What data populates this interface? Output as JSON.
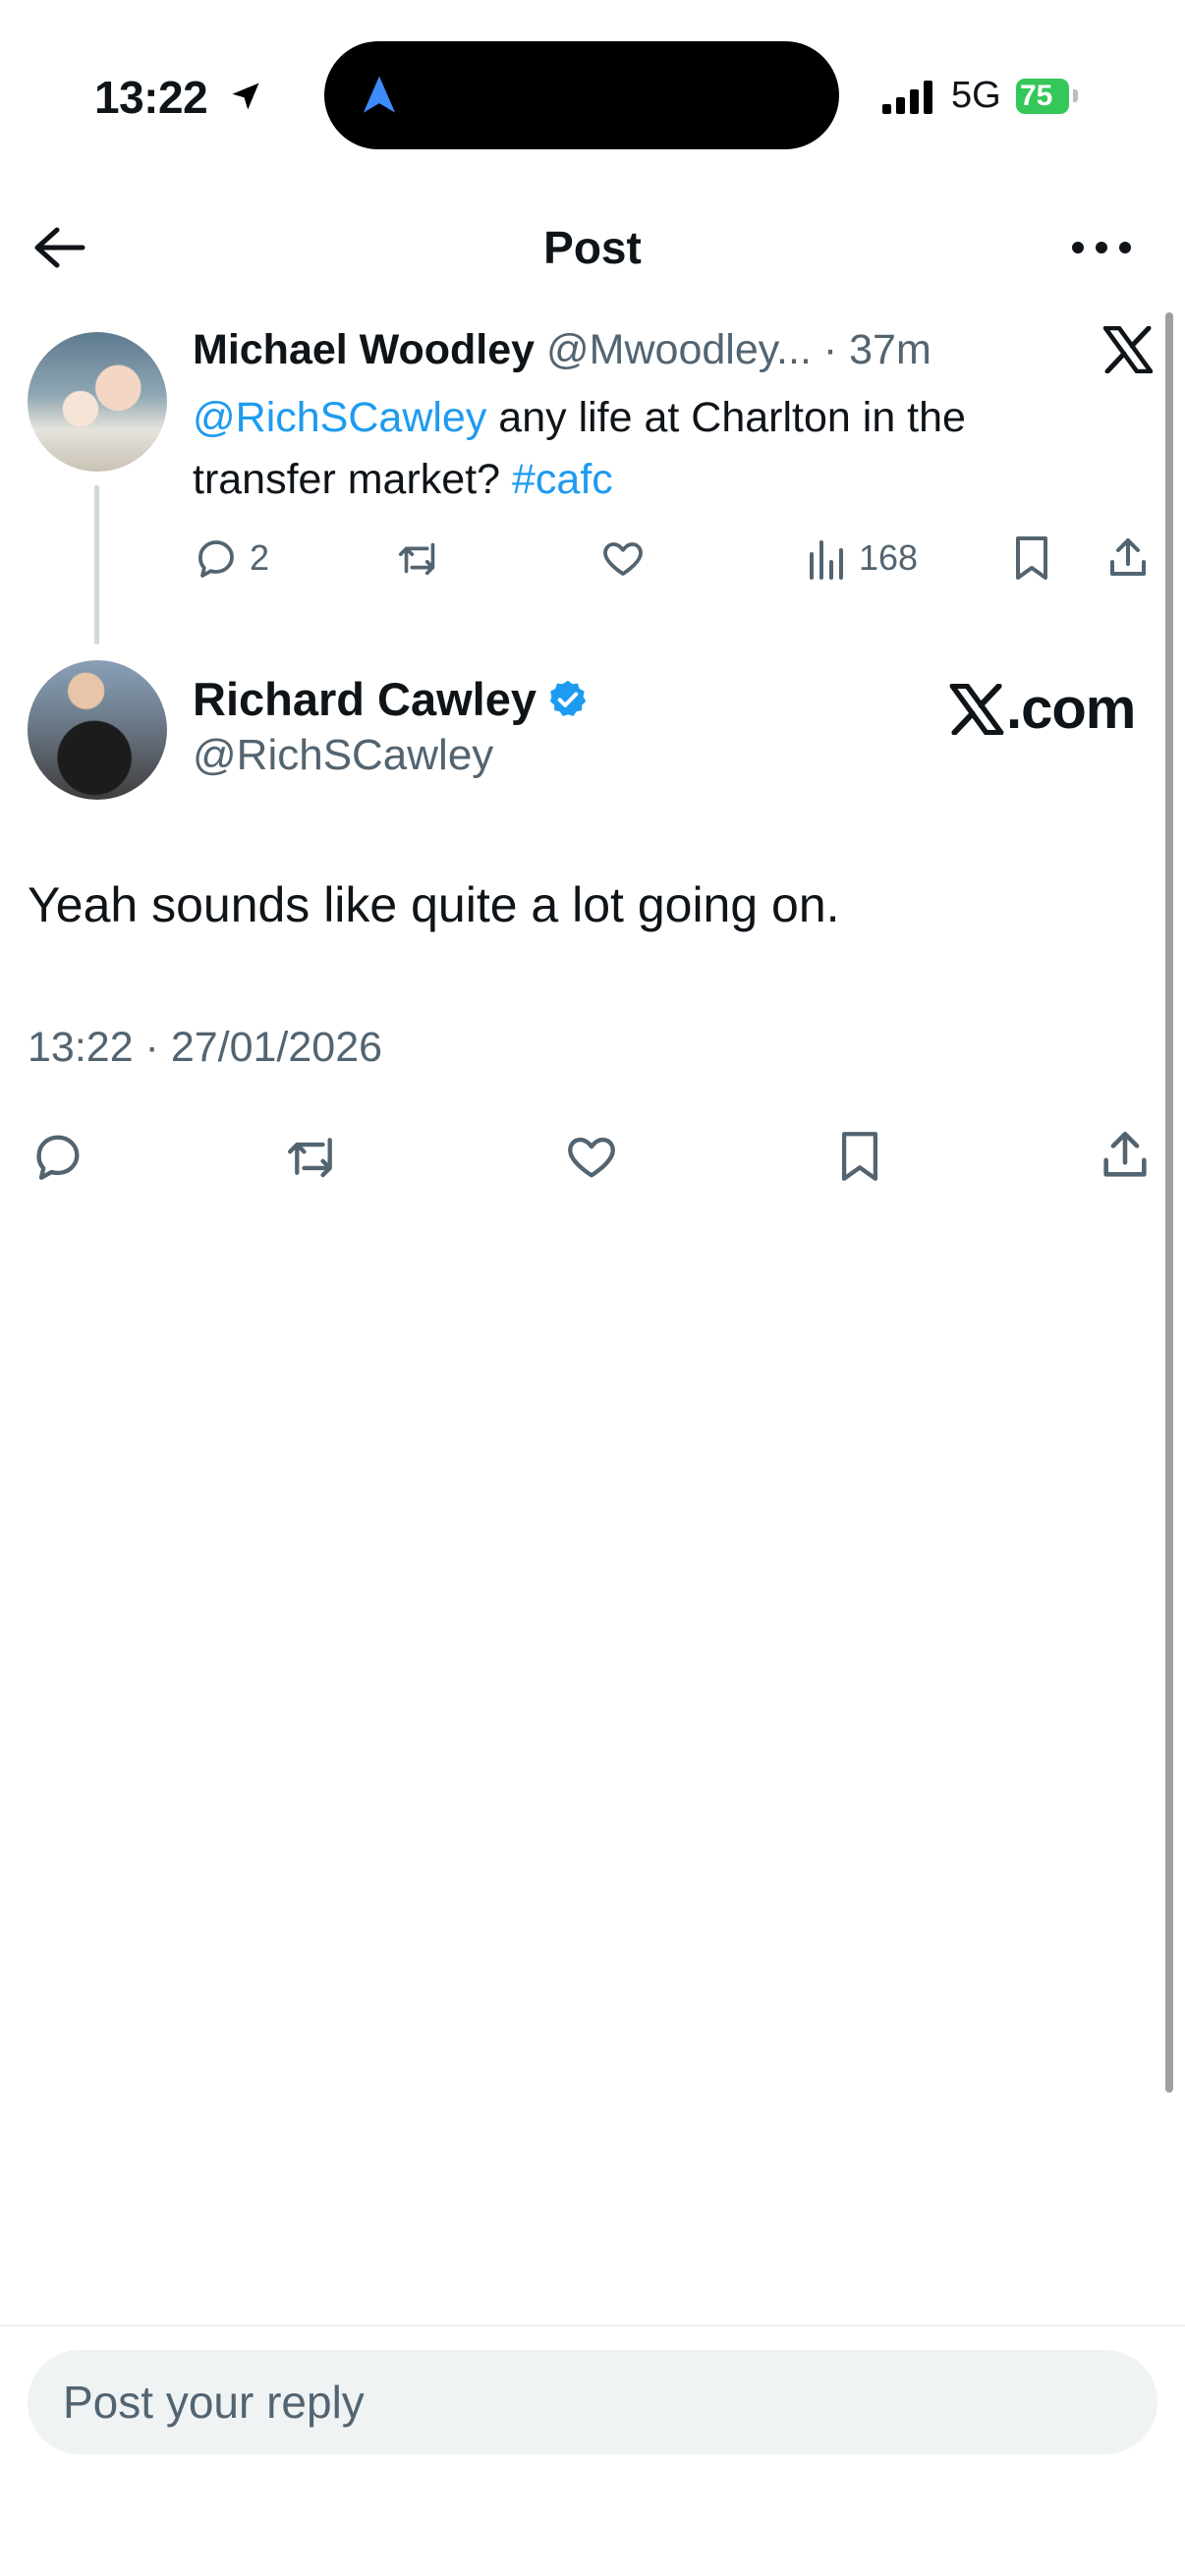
{
  "status_bar": {
    "time": "13:22",
    "network": "5G",
    "battery": "75"
  },
  "header": {
    "title": "Post",
    "back_icon": "arrow-left-icon",
    "more_icon": "more-horizontal-icon"
  },
  "parent_tweet": {
    "author_name": "Michael Woodley",
    "author_handle": "@Mwoodley...",
    "separator": " · ",
    "time_ago": "37m",
    "text_mention": "@RichSCawley",
    "text_body": " any life at Charlton in the transfer market? ",
    "text_hashtag": "#cafc",
    "reply_count": "2",
    "view_count": "168"
  },
  "focused_tweet": {
    "author_name": "Richard Cawley",
    "author_handle": "@RichSCawley",
    "brand_suffix": ".com",
    "text": "Yeah sounds like quite a lot going on.",
    "timestamp": "13:22 · 27/01/2026"
  },
  "reply": {
    "placeholder": "Post your reply"
  },
  "colors": {
    "link": "#1d9bf0",
    "secondary_text": "#536471",
    "battery": "#34c759",
    "composer_bg": "#eff3f4"
  }
}
